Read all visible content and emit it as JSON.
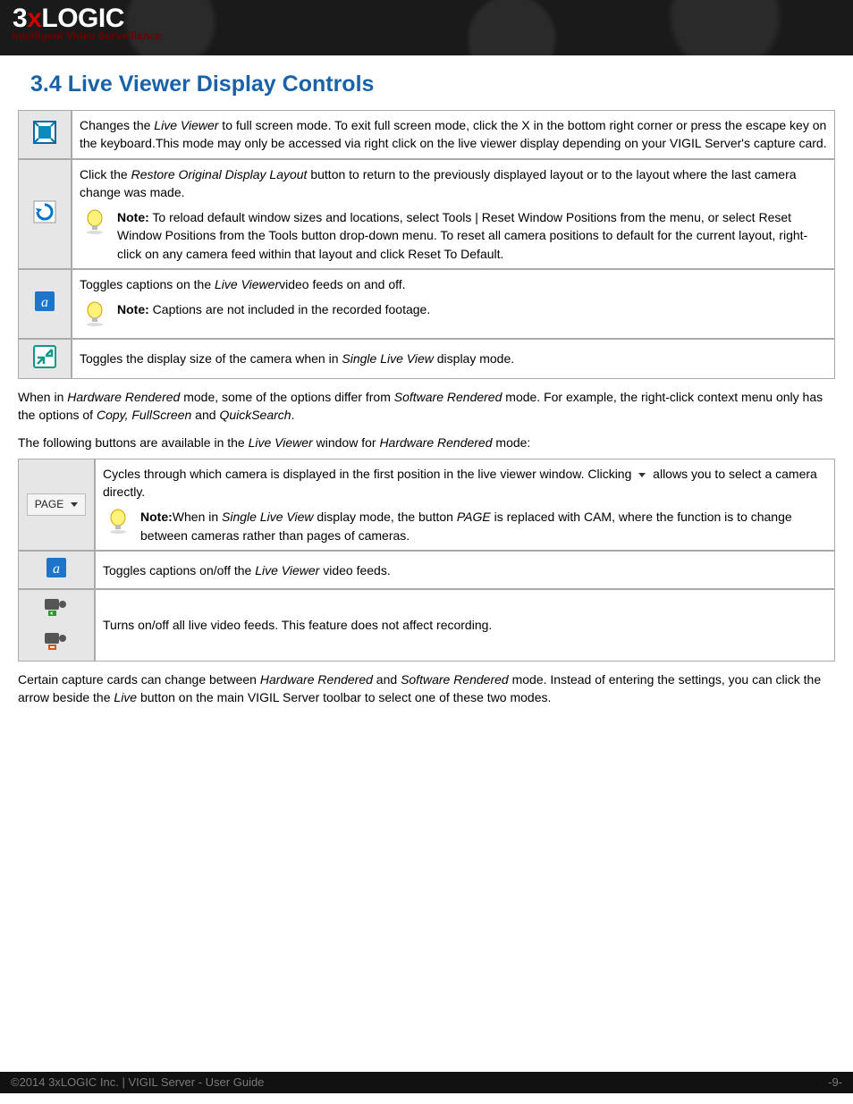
{
  "header": {
    "logo_pre": "3",
    "logo_x": "x",
    "logo_post": "LOGIC",
    "tagline": "Intelligent Video Surveillance"
  },
  "section": {
    "number": "3.4",
    "title": "Live Viewer Display Controls"
  },
  "table1": {
    "rows": [
      {
        "icon": "fullscreen-icon",
        "desc_pre": "Changes the ",
        "desc_em1": "Live Viewer",
        "desc_post": " to full screen mode. To exit full screen mode, click the X in the bottom right corner or press the escape key on the keyboard.This mode may only be accessed via right click on the live viewer display depending on your VIGIL Server's capture card."
      },
      {
        "icon": "restore-layout-icon",
        "desc_pre": "Click the ",
        "desc_em1": "Restore Original Display Layout",
        "desc_post": " button to return to the previously displayed layout or to the layout where the last camera change was made.",
        "note_label": "Note:",
        "note_text": " To reload default window sizes and locations, select Tools | Reset Window Positions from the menu, or select Reset Window Positions from the Tools button drop-down menu.  To reset all camera positions to default for the current layout, right-click on any camera feed within that layout and click Reset To Default."
      },
      {
        "icon": "caption-a-icon",
        "desc_pre": "Toggles captions on the ",
        "desc_em1": "Live Viewer",
        "desc_post": "video feeds on and off.",
        "note_label": "Note:",
        "note_text": " Captions are not included in the recorded footage."
      },
      {
        "icon": "display-size-icon",
        "desc_pre": "Toggles the display size of the camera when in ",
        "desc_em1": "Single Live View",
        "desc_post": " display mode."
      }
    ]
  },
  "mid": {
    "p1_pre": "When in ",
    "p1_em1": "Hardware Rendered",
    "p1_mid1": " mode, some of the options differ from ",
    "p1_em2": "Software Rendered",
    "p1_mid2": " mode. For example, the right-click context menu only has the options of ",
    "p1_em3": "Copy, FullScreen",
    "p1_mid3": " and ",
    "p1_em4": "QuickSearch",
    "p1_end": ".",
    "p2_pre": "The following buttons are available in the ",
    "p2_em1": "Live Viewer",
    "p2_mid": " window for ",
    "p2_em2": "Hardware Rendered",
    "p2_end": " mode:"
  },
  "table2": {
    "rows": [
      {
        "icon": "page-button",
        "btn_label": "PAGE",
        "desc_pre": "Cycles through which camera is displayed in the first position in the live viewer window. Clicking ",
        "desc_mid": " allows you to select a camera directly.",
        "note_label": "Note:",
        "note_pre": "When in ",
        "note_em1": "Single Live View",
        "note_mid": " display mode, the button ",
        "note_em2": "PAGE",
        "note_post": " is replaced with CAM, where the function is to change between cameras rather than pages of cameras."
      },
      {
        "icon": "caption-a-icon",
        "desc_pre": "Toggles captions on/off the ",
        "desc_em1": "Live Viewer",
        "desc_post": " video feeds."
      },
      {
        "icon": "video-toggle-icons",
        "desc": "Turns on/off all live video feeds. This feature does not affect recording."
      }
    ]
  },
  "bottom": {
    "p_pre": "Certain capture cards can change between ",
    "p_em1": "Hardware Rendered",
    "p_mid1": " and ",
    "p_em2": "Software Rendered",
    "p_mid2": " mode. Instead of entering the settings, you can click the arrow beside the ",
    "p_em3": "Live",
    "p_end": " button on the main VIGIL Server toolbar to select one of these two modes."
  },
  "footer": {
    "left": "©2014 3xLOGIC Inc. | VIGIL Server - User Guide",
    "right": "-9-"
  }
}
